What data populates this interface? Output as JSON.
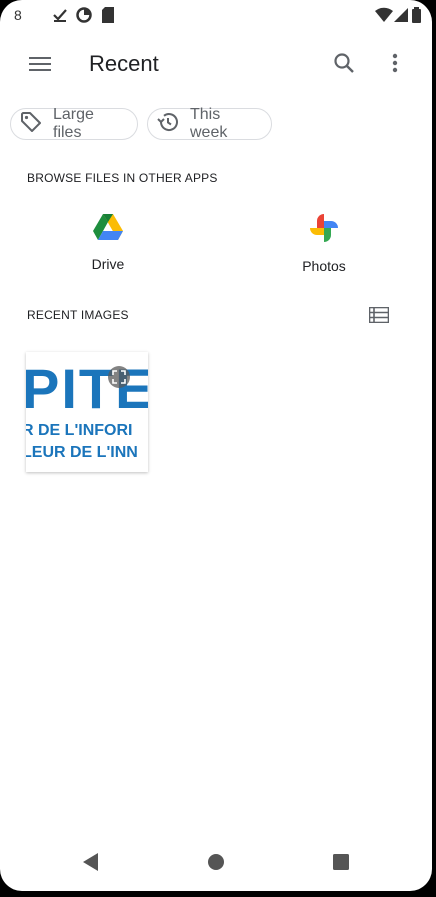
{
  "status_bar": {
    "time": "8",
    "icons": [
      "check-icon",
      "data-saver-icon",
      "sd-card-icon",
      "wifi-icon",
      "signal-icon",
      "battery-icon"
    ]
  },
  "app_bar": {
    "title": "Recent",
    "icons": [
      "menu-icon",
      "search-icon",
      "more-vert-icon"
    ]
  },
  "chips": [
    {
      "label": "Large files",
      "icon": "tag-icon"
    },
    {
      "label": "This week",
      "icon": "history-icon"
    }
  ],
  "browse_section": {
    "label": "BROWSE FILES IN OTHER APPS",
    "apps": [
      {
        "label": "Drive",
        "icon": "google-drive-icon"
      },
      {
        "label": "Photos",
        "icon": "google-photos-icon"
      }
    ]
  },
  "recent_images": {
    "label": "RECENT IMAGES",
    "view_toggle_icon": "list-view-icon",
    "items": [
      {
        "thumb_text_1": "PITEC",
        "thumb_text_2": "R DE L'INFORI",
        "thumb_text_3": "LEUR DE L'INN"
      }
    ]
  },
  "nav_bar": {
    "icons": [
      "back-icon",
      "home-icon",
      "recents-icon"
    ]
  },
  "colors": {
    "background": "#ffffff",
    "text_primary": "#202124",
    "text_secondary": "#5f6368",
    "chip_border": "#dadce0",
    "thumb_blue": "#1b75bb"
  }
}
